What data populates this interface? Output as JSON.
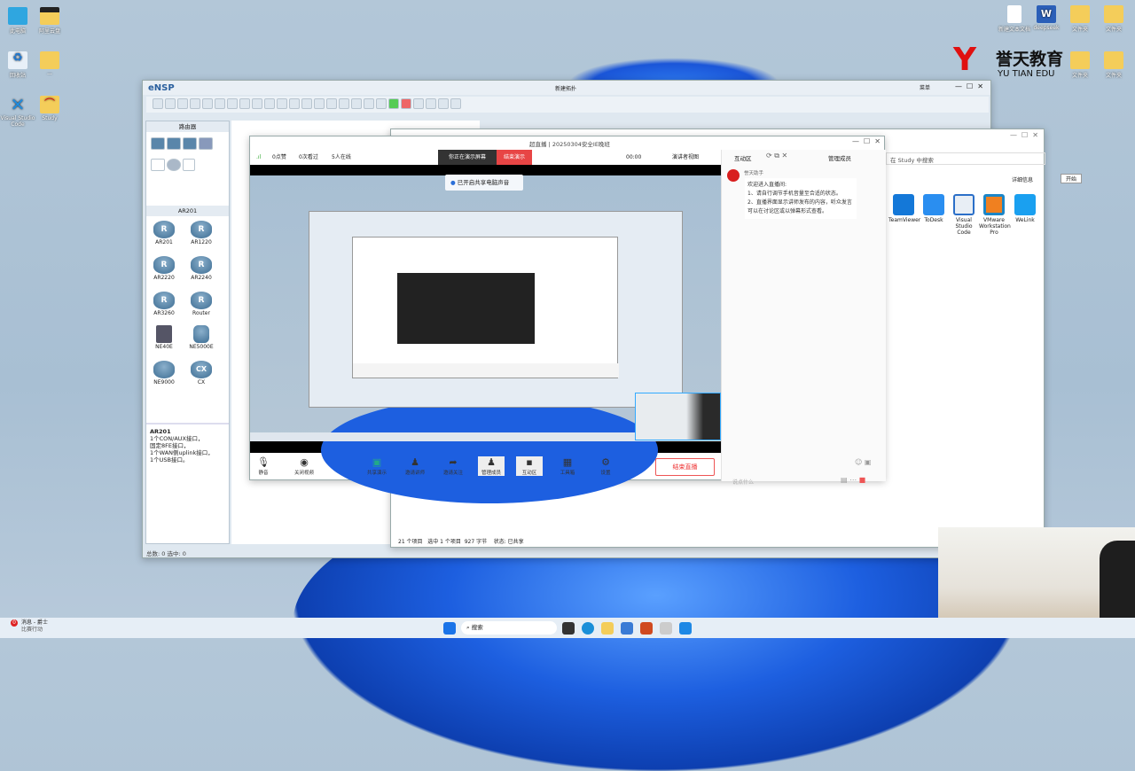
{
  "desktop": {
    "icons_left": [
      "此电脑",
      "阿里云盘",
      "回收站",
      "—",
      "Visual Studio Code",
      "Study"
    ],
    "icons_right": [
      "新建文本文档",
      "deepseek",
      "文件夹",
      "文件夹",
      "文件夹",
      "文件夹"
    ]
  },
  "logo": {
    "cn": "誉天教育",
    "en": "YU TIAN EDU"
  },
  "ensp": {
    "app_title": "eNSP",
    "window_title": "新建拓扑",
    "menu_label": "菜单",
    "category": "路由器",
    "subcategory": "AR201",
    "devices": [
      "AR201",
      "AR1220",
      "AR2220",
      "AR2240",
      "AR3260",
      "Router",
      "NE40E",
      "NE5000E",
      "NE9000",
      "CX"
    ],
    "desc_title": "AR201",
    "desc_lines": [
      "1个CON/AUX接口，",
      "固定8FE接口，",
      "1个WAN侧uplink接口，",
      "1个USB接口。"
    ],
    "status": "总数: 0 选中: 0"
  },
  "explorer": {
    "search_placeholder": "在 Study 中搜索",
    "details": "详细信息",
    "apps": [
      "TeamViewer",
      "ToDesk",
      "Visual Studio Code",
      "VMware Workstation Pro",
      "WeLink"
    ],
    "status": "21 个项目   选中 1 个项目  927 字节    状态: 已共享"
  },
  "start_tip": "开始",
  "live": {
    "title": "超直播 | 20250304安全IE晚班",
    "likes": "0点赞",
    "replays": "0次看过",
    "online": "5人在线",
    "presenting": "你正在演示屏幕",
    "stop_present": "结束演示",
    "timer": "00:00",
    "view_mode": "演讲者视图",
    "share_audio": "已开启共享电脑声音",
    "panel_tab": "互动区",
    "manage": "管理成员",
    "sender": "誉天助手",
    "message": [
      "欢迎进入直播间:",
      "1、请自行调节手机音量至合适的状态。",
      "2、直播界面显示讲师发布的内容，听众发言可以在讨论区或以弹幕形式查看。"
    ],
    "chat_placeholder": "说点什么",
    "toolbar": [
      "静音",
      "关闭视频",
      "共享演示",
      "邀请讲师",
      "邀请关注",
      "管理成员",
      "互动区",
      "工具箱",
      "设置"
    ],
    "end_live": "结束直播"
  },
  "taskbar": {
    "weather_temp": "0",
    "weather_title": "消息 - 爵士",
    "weather_sub": "比赛行动",
    "search": "搜索"
  }
}
